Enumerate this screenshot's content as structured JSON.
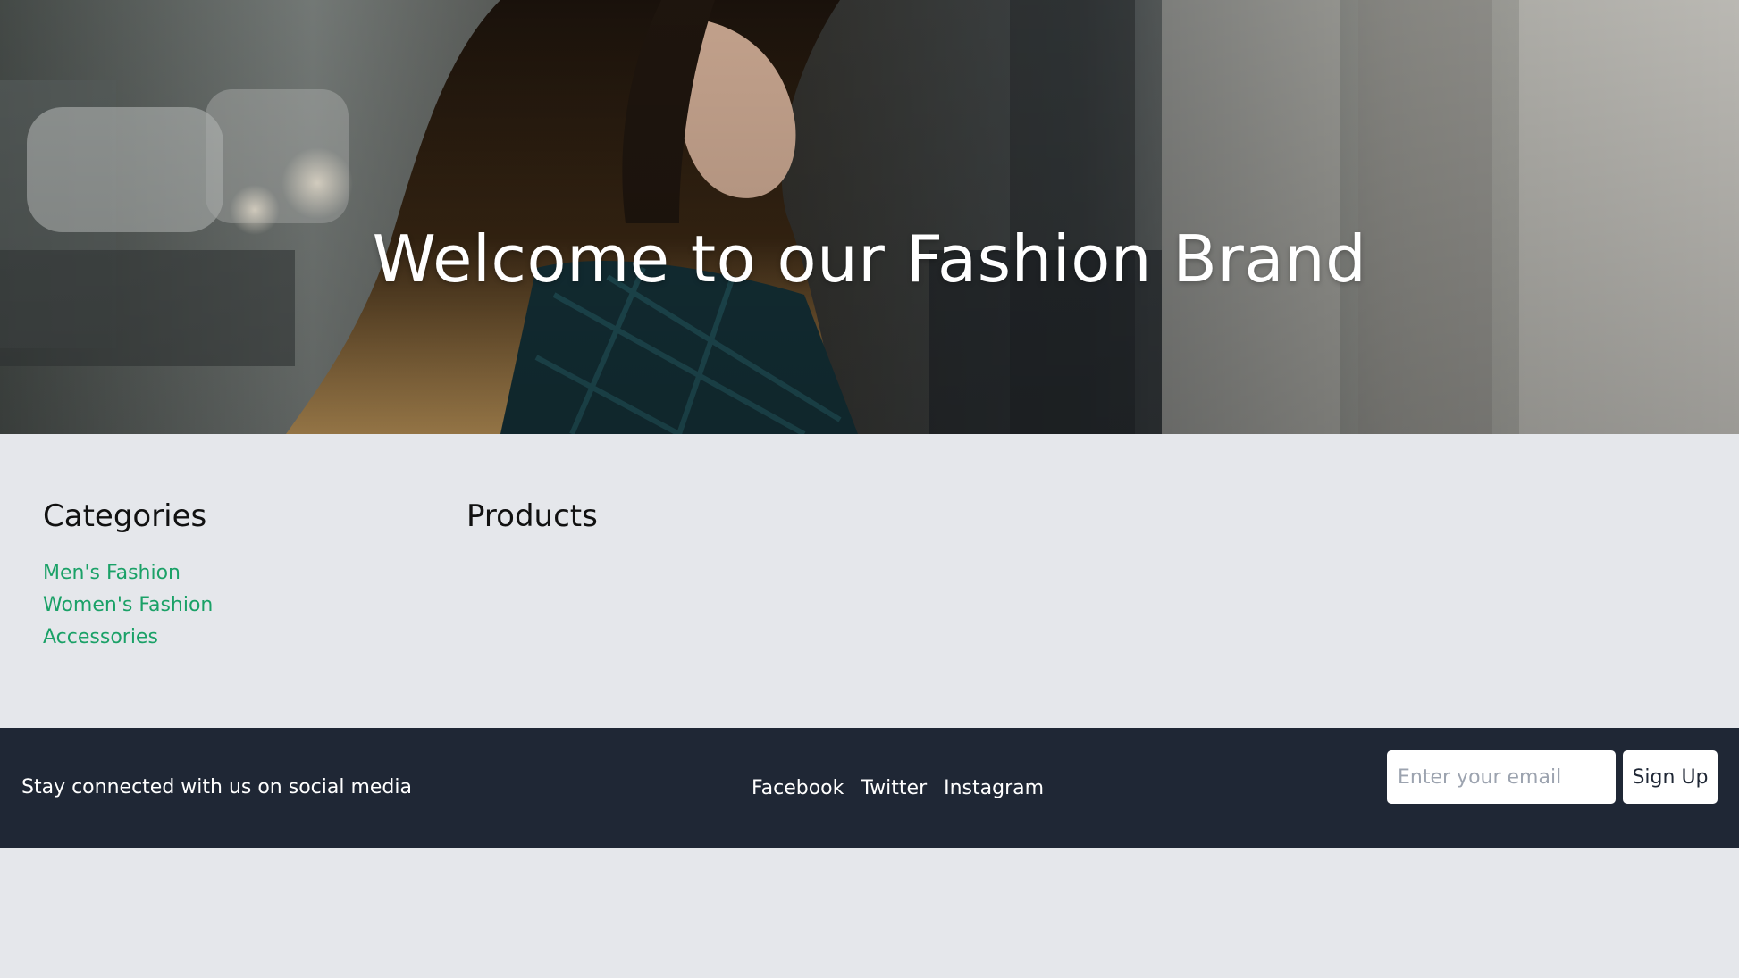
{
  "hero": {
    "title": "Welcome to our Fashion Brand"
  },
  "categories": {
    "heading": "Categories",
    "items": [
      "Men's Fashion",
      "Women's Fashion",
      "Accessories"
    ]
  },
  "products": {
    "heading": "Products"
  },
  "footer": {
    "tagline": "Stay connected with us on social media",
    "social_links": [
      "Facebook",
      "Twitter",
      "Instagram"
    ],
    "email_placeholder": "Enter your email",
    "signup_label": "Sign Up"
  },
  "colors": {
    "page_background": "#e5e7eb",
    "link_accent": "#1aa167",
    "footer_background": "#1f2735",
    "text_dark": "#111111"
  }
}
